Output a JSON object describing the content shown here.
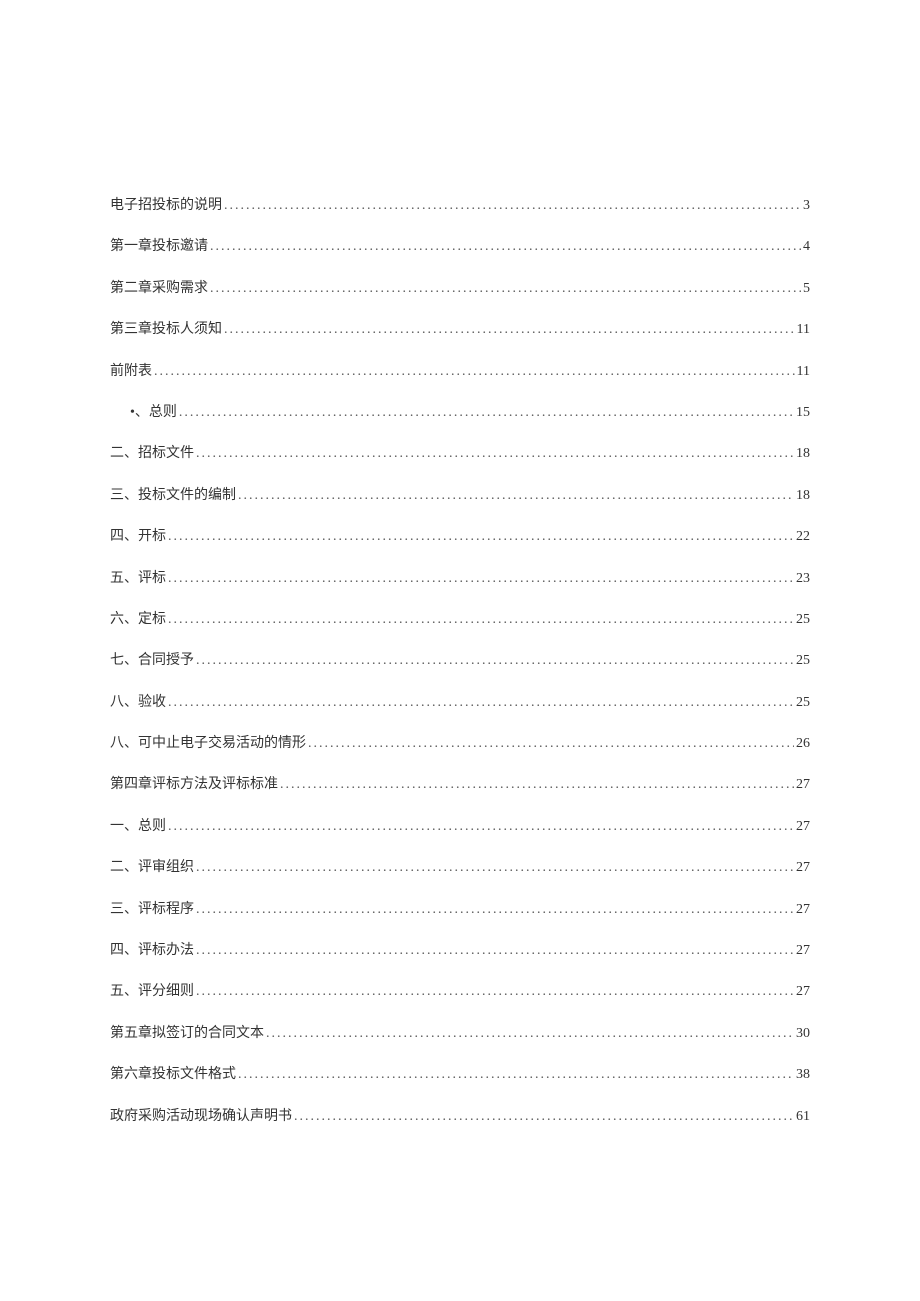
{
  "toc": {
    "entries": [
      {
        "title": "电子招投标的说明 ",
        "page": "3",
        "indented": false
      },
      {
        "title": "第一章投标邀请 ",
        "page": "4",
        "indented": false
      },
      {
        "title": "第二章采购需求 ",
        "page": "5",
        "indented": false
      },
      {
        "title": "第三章投标人须知 ",
        "page": "11",
        "indented": false
      },
      {
        "title": "前附表 ",
        "page": "11",
        "indented": false
      },
      {
        "title": "•、总则",
        "page": "15",
        "indented": true
      },
      {
        "title": "二、招标文件 ",
        "page": "18",
        "indented": false
      },
      {
        "title": "三、投标文件的编制 ",
        "page": "18",
        "indented": false
      },
      {
        "title": "四、开标 ",
        "page": "22",
        "indented": false
      },
      {
        "title": "五、评标 ",
        "page": "23",
        "indented": false
      },
      {
        "title": "六、定标 ",
        "page": "25",
        "indented": false
      },
      {
        "title": "七、合同授予 ",
        "page": "25",
        "indented": false
      },
      {
        "title": "八、验收 ",
        "page": "25",
        "indented": false
      },
      {
        "title": "八、可中止电子交易活动的情形 ",
        "page": "26",
        "indented": false
      },
      {
        "title": "第四章评标方法及评标标准 ",
        "page": "27",
        "indented": false
      },
      {
        "title": "一、总则 ",
        "page": "27",
        "indented": false
      },
      {
        "title": "二、评审组织 ",
        "page": "27",
        "indented": false
      },
      {
        "title": "三、评标程序 ",
        "page": "27",
        "indented": false
      },
      {
        "title": "四、评标办法 ",
        "page": "27",
        "indented": false
      },
      {
        "title": "五、评分细则 ",
        "page": "27",
        "indented": false
      },
      {
        "title": "第五章拟签订的合同文本 ",
        "page": "30",
        "indented": false
      },
      {
        "title": "第六章投标文件格式 ",
        "page": "38",
        "indented": false
      },
      {
        "title": "政府采购活动现场确认声明书 ",
        "page": "61",
        "indented": false
      }
    ]
  }
}
